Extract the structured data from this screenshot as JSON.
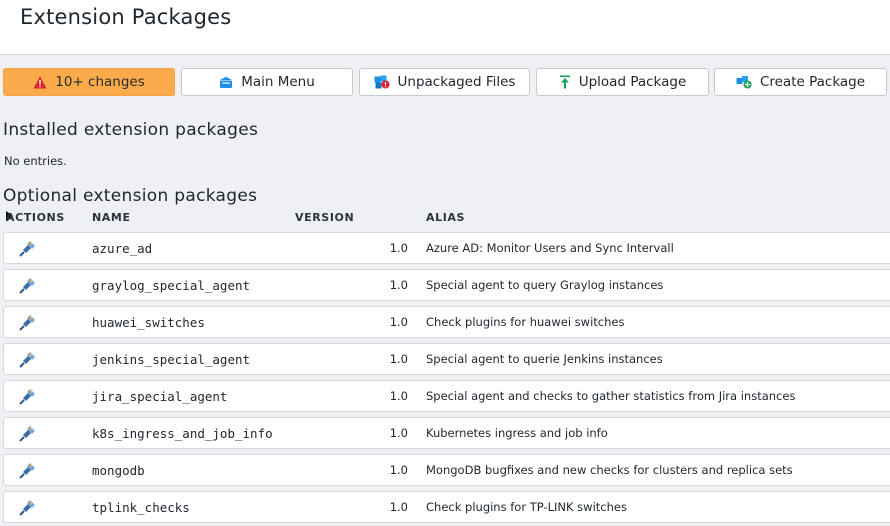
{
  "page": {
    "title": "Extension Packages"
  },
  "toolbar": {
    "changes_label": "10+ changes",
    "main_menu_label": "Main Menu",
    "unpackaged_label": "Unpackaged Files",
    "upload_label": "Upload Package",
    "create_label": "Create Package"
  },
  "installed": {
    "title": "Installed extension packages",
    "empty_text": "No entries."
  },
  "optional": {
    "title": "Optional extension packages",
    "columns": {
      "actions": "ACTIONS",
      "name": "NAME",
      "version": "VERSION",
      "alias": "ALIAS"
    },
    "rows": [
      {
        "name": "azure_ad",
        "version": "1.0",
        "alias": "Azure AD: Monitor Users and Sync Intervall"
      },
      {
        "name": "graylog_special_agent",
        "version": "1.0",
        "alias": "Special agent to query Graylog instances"
      },
      {
        "name": "huawei_switches",
        "version": "1.0",
        "alias": "Check plugins for huawei switches"
      },
      {
        "name": "jenkins_special_agent",
        "version": "1.0",
        "alias": "Special agent to querie Jenkins instances"
      },
      {
        "name": "jira_special_agent",
        "version": "1.0",
        "alias": "Special agent and checks to gather statistics from Jira instances"
      },
      {
        "name": "k8s_ingress_and_job_info",
        "version": "1.0",
        "alias": "Kubernetes ingress and job info"
      },
      {
        "name": "mongodb",
        "version": "1.0",
        "alias": "MongoDB bugfixes and new checks for clusters and replica sets"
      },
      {
        "name": "tplink_checks",
        "version": "1.0",
        "alias": "Check plugins for TP-LINK switches"
      }
    ]
  },
  "icons": {
    "changes": "warning-icon",
    "main_menu": "main-menu-icon",
    "unpackaged": "unpackaged-files-icon",
    "upload": "upload-icon",
    "create": "create-package-icon",
    "row_action": "install-icon"
  },
  "colors": {
    "accent": "#fbab4b",
    "background": "#eef0f3",
    "warning": "#e0202a",
    "icon_blue": "#1a8fe3",
    "icon_green": "#15a05a"
  }
}
